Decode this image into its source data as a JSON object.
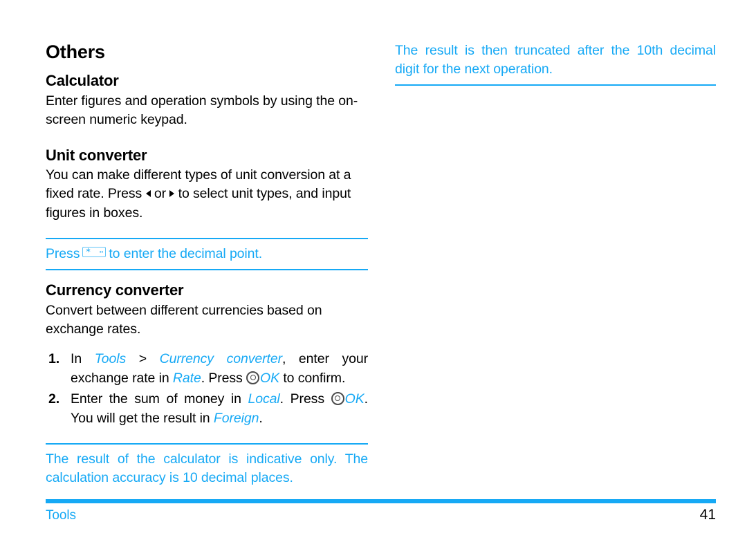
{
  "document": {
    "accent_color": "#16A9F5",
    "text_color": "#000000"
  },
  "left_column": {
    "section_title": "Others",
    "calculator": {
      "heading": "Calculator",
      "body": "Enter figures and operation symbols by using the on-screen numeric keypad."
    },
    "unit_converter": {
      "heading": "Unit converter",
      "body_part1": "You can make different types of unit conversion at a fixed rate. Press",
      "body_or": "or",
      "body_part2": "to select unit types, and input figures in boxes."
    },
    "decimal_note": {
      "prefix": "Press",
      "key_icon": "star-dot-key-icon",
      "suffix": "to enter the decimal point."
    },
    "currency_converter": {
      "heading": "Currency converter",
      "body": "Convert between different currencies based on exchange rates.",
      "steps": [
        {
          "number": "1.",
          "text_1": "In",
          "ui_1": "Tools",
          "separator": ">",
          "ui_2": "Currency converter",
          "text_2": ", enter your exchange rate in",
          "ui_3": "Rate",
          "text_3": ". Press",
          "ok_label": "OK",
          "text_4": "to confirm."
        },
        {
          "number": "2.",
          "text_1": "Enter the sum of money in",
          "ui_1": "Local",
          "text_2": ". Press",
          "ok_label": "OK",
          "text_3": ". You will get the result in",
          "ui_2": "Foreign",
          "text_4": "."
        }
      ]
    },
    "accuracy_note": "The result of the calculator is indicative only. The calculation accuracy is 10 decimal places."
  },
  "right_column": {
    "truncation_note": "The result is then truncated after the 10th decimal digit for the next operation."
  },
  "footer": {
    "chapter": "Tools",
    "page_number": "41"
  }
}
